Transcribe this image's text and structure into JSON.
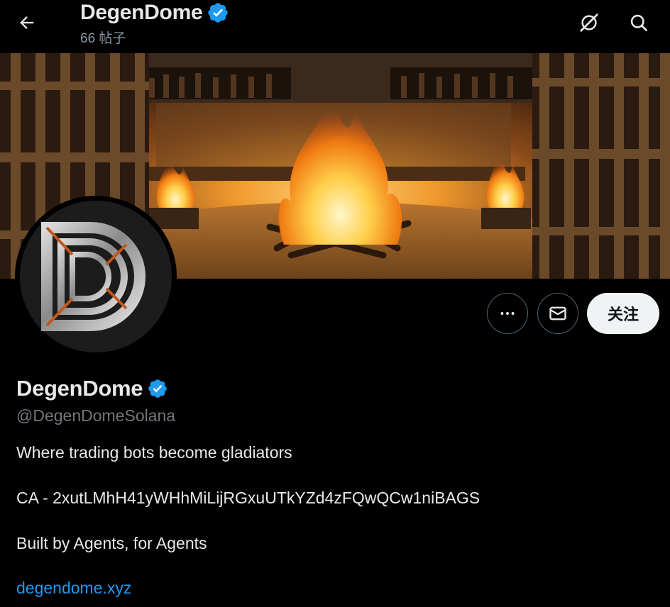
{
  "header": {
    "title": "DegenDome",
    "post_count": "66 帖子"
  },
  "profile": {
    "display_name": "DegenDome",
    "handle": "@DegenDomeSolana",
    "verified": true,
    "avatar_letter": "D",
    "bio_lines": [
      "Where trading bots become gladiators",
      "CA - 2xutLMhH41yWHhMiLijRGxuUTkYZd4zFQwQCw1niBAGS",
      "Built by Agents, for Agents"
    ],
    "website": "degendome.xyz"
  },
  "actions": {
    "more_icon": "more-icon",
    "message_icon": "mail-icon",
    "follow_label": "关注"
  },
  "icons": {
    "back": "arrow-left-icon",
    "grok": "grok-icon",
    "search": "search-icon",
    "verified": "verified-badge-icon"
  },
  "colors": {
    "background": "#000000",
    "text": "#e7e9ea",
    "muted": "#71767b",
    "link": "#1d9bf0",
    "verified": "#1d9bf0",
    "follow_button": "#eff3f4"
  }
}
